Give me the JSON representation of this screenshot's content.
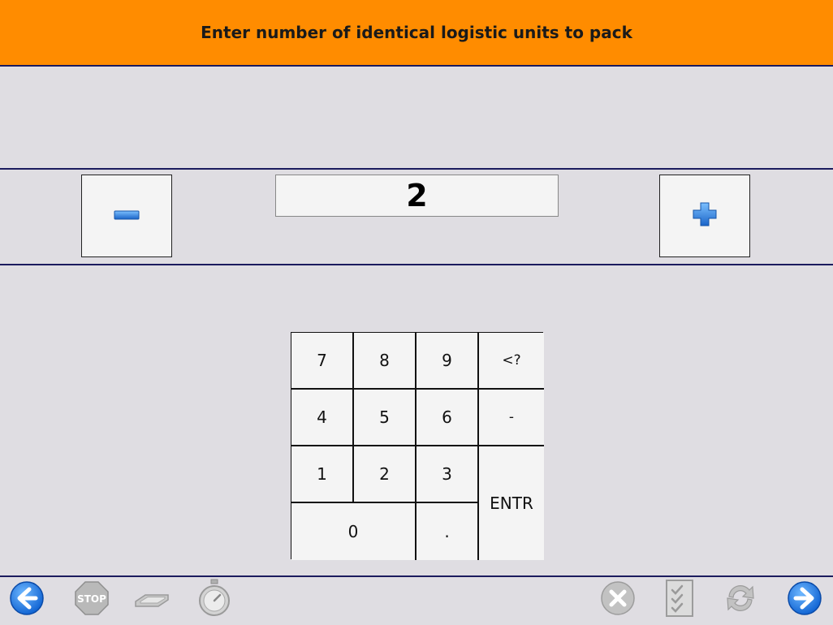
{
  "header": {
    "title": "Enter number of identical logistic units to pack"
  },
  "quantity": {
    "value": "2"
  },
  "stepper": {
    "decrement_icon": "minus-icon",
    "increment_icon": "plus-icon"
  },
  "keypad": {
    "keys": {
      "k7": "7",
      "k8": "8",
      "k9": "9",
      "backspace": "<?",
      "k4": "4",
      "k5": "5",
      "k6": "6",
      "minus": "-",
      "k1": "1",
      "k2": "2",
      "k3": "3",
      "enter": "ENTR",
      "k0": "0",
      "dot": "."
    }
  },
  "footer": {
    "icons": [
      "back-arrow-icon",
      "stop-sign-icon",
      "scanner-icon",
      "stopwatch-icon",
      "cancel-icon",
      "checklist-icon",
      "refresh-icon",
      "forward-arrow-icon"
    ],
    "stop_label": "STOP"
  },
  "colors": {
    "header_bg": "#ff8c00",
    "page_bg": "#dfdde2",
    "divider": "#1b1b5e",
    "accent_blue": "#1e7de0"
  }
}
